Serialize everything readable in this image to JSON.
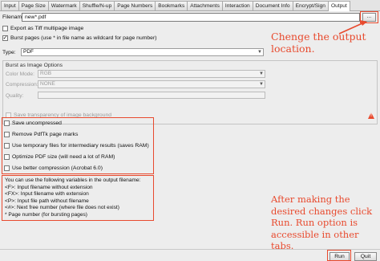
{
  "tabs": [
    {
      "label": "Input"
    },
    {
      "label": "Page Size"
    },
    {
      "label": "Watermark"
    },
    {
      "label": "Shuffle/N-up"
    },
    {
      "label": "Page Numbers"
    },
    {
      "label": "Bookmarks"
    },
    {
      "label": "Attachments"
    },
    {
      "label": "Interaction"
    },
    {
      "label": "Document Info"
    },
    {
      "label": "Encrypt/Sign"
    },
    {
      "label": "Output",
      "active": true
    }
  ],
  "filename": {
    "label": "Filename:",
    "value": "new*.pdf",
    "browse_label": "..."
  },
  "export_tiff": {
    "label": "Export as Tiff multipage image",
    "checked": false
  },
  "burst_pages": {
    "label": "Burst pages (use * in file name as wildcard for page number)",
    "checked": true
  },
  "type": {
    "label": "Type:",
    "value": "PDF"
  },
  "burst_image": {
    "title": "Burst as Image Options",
    "color_mode_label": "Color Mode:",
    "color_mode_value": "RGB",
    "compression_label": "Compression:",
    "compression_value": "NONE",
    "quality_label": "Quality:",
    "transparency_label": "Save transparency of image background"
  },
  "options": [
    {
      "label": "Save uncompressed",
      "checked": false
    },
    {
      "label": "Remove PdfTk page marks",
      "checked": false
    },
    {
      "label": "Use temporary files for intermediary results (saves RAM)",
      "checked": false
    },
    {
      "label": "Optimize PDF size (will need a lot of RAM)",
      "checked": false
    },
    {
      "label": "Use better compression (Acrobat 6.0)",
      "checked": false
    }
  ],
  "variables_info": "You can use the following variables in the output filename:\n<F>: Input filename without extension\n<FX>: Input filename with extension\n<P>: Input file path without filename\n<#>: Next free number (where file does not exist)\n* Page number (for bursting pages)",
  "annotations": {
    "top": "Chenge the output location.",
    "bottom": "After making the desired changes click Run. Run option is accessible in other tabs."
  },
  "footer": {
    "run_label": "Run",
    "quit_label": "Quit"
  },
  "colors": {
    "annotation": "#e84a2e",
    "background": "#ededed"
  }
}
